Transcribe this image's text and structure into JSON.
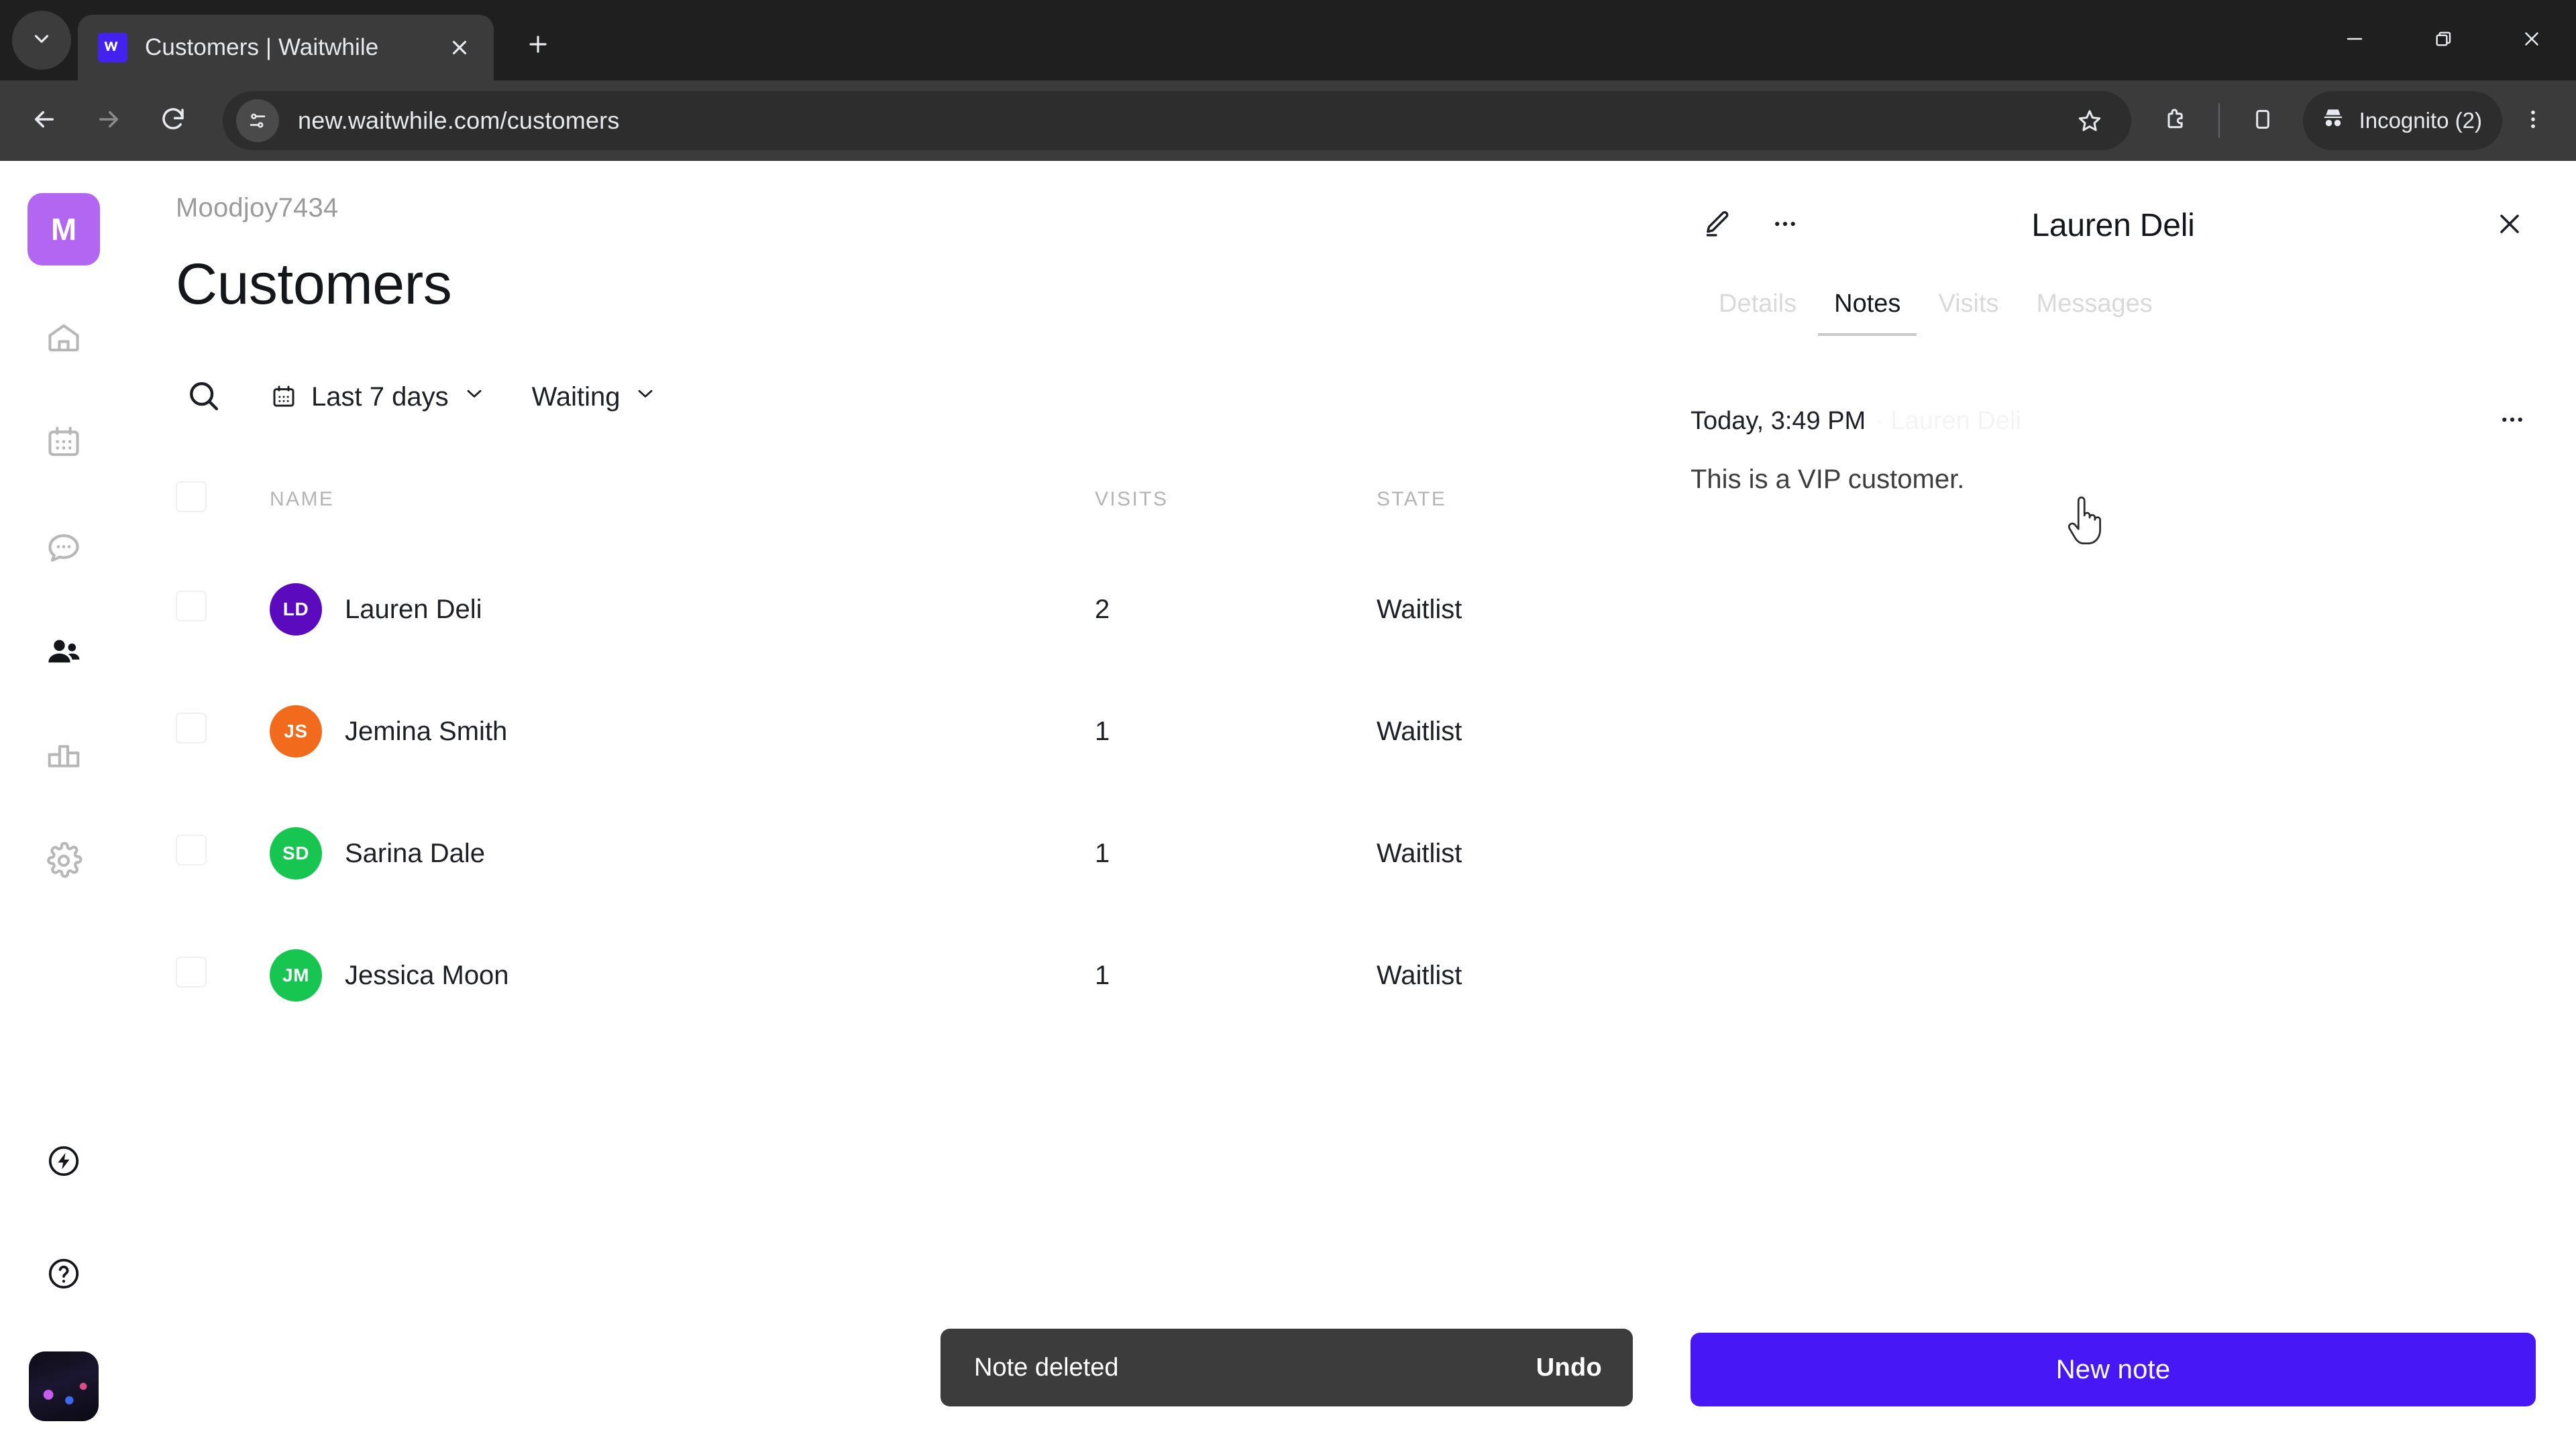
{
  "browser": {
    "tab": {
      "title": "Customers | Waitwhile",
      "favicon_icon": "waitwhile-logo-icon"
    },
    "tab_list_icon": "chevron-down-icon",
    "new_tab_icon": "plus-icon",
    "tab_close_icon": "close-icon",
    "window": {
      "minimize_icon": "minimize-icon",
      "maximize_icon": "restore-icon",
      "close_icon": "close-icon"
    },
    "nav": {
      "back_icon": "arrow-left-icon",
      "forward_icon": "arrow-right-icon",
      "reload_icon": "reload-icon"
    },
    "omnibox": {
      "site_info_icon": "page-settings-icon",
      "url": "new.waitwhile.com/customers"
    },
    "actions": {
      "bookmark_icon": "star-icon",
      "extensions_icon": "extensions-icon",
      "side_panel_icon": "side-panel-icon",
      "incognito_icon": "incognito-icon",
      "incognito_label": "Incognito (2)",
      "menu_icon": "three-dots-vertical-icon"
    }
  },
  "sidebar": {
    "brand_initial": "M",
    "items": [
      {
        "name": "home",
        "icon": "home-icon",
        "active": false
      },
      {
        "name": "calendar",
        "icon": "calendar-icon",
        "active": false
      },
      {
        "name": "messages",
        "icon": "chat-bubble-icon",
        "active": false
      },
      {
        "name": "customers",
        "icon": "people-icon",
        "active": true
      },
      {
        "name": "analytics",
        "icon": "bar-chart-icon",
        "active": false
      },
      {
        "name": "settings",
        "icon": "gear-icon",
        "active": false
      }
    ],
    "bottom_items": [
      {
        "name": "whats-new",
        "icon": "bolt-circle-icon"
      },
      {
        "name": "help",
        "icon": "question-circle-icon"
      }
    ],
    "avatar": "user-avatar"
  },
  "main": {
    "org_name": "Moodjoy7434",
    "page_title": "Customers",
    "filters": {
      "search_icon": "search-icon",
      "date_range": {
        "icon": "calendar-icon",
        "label": "Last 7 days",
        "chevron": "chevron-down-icon"
      },
      "status": {
        "label": "Waiting",
        "chevron": "chevron-down-icon"
      }
    },
    "table": {
      "columns": [
        "NAME",
        "VISITS",
        "STATE"
      ],
      "rows": [
        {
          "initials": "LD",
          "name": "Lauren Deli",
          "visits": "2",
          "state": "Waitlist",
          "color": "#5b0bbd"
        },
        {
          "initials": "JS",
          "name": "Jemina Smith",
          "visits": "1",
          "state": "Waitlist",
          "color": "#f26a1b"
        },
        {
          "initials": "SD",
          "name": "Sarina Dale",
          "visits": "1",
          "state": "Waitlist",
          "color": "#17c651"
        },
        {
          "initials": "JM",
          "name": "Jessica Moon",
          "visits": "1",
          "state": "Waitlist",
          "color": "#17c651"
        }
      ]
    }
  },
  "right_panel": {
    "edit_icon": "pencil-icon",
    "more_icon": "three-dots-icon",
    "title": "Lauren Deli",
    "close_icon": "close-icon",
    "tabs": [
      {
        "label": "Details",
        "active": false
      },
      {
        "label": "Notes",
        "active": true
      },
      {
        "label": "Visits",
        "active": false
      },
      {
        "label": "Messages",
        "active": false
      }
    ],
    "note": {
      "time": "Today, 3:49 PM",
      "author": "· Lauren Deli",
      "more_icon": "three-dots-icon",
      "body": "This is a VIP customer."
    },
    "new_note_label": "New note",
    "accent_color": "#4718f5"
  },
  "snackbar": {
    "message": "Note deleted",
    "action_label": "Undo"
  }
}
